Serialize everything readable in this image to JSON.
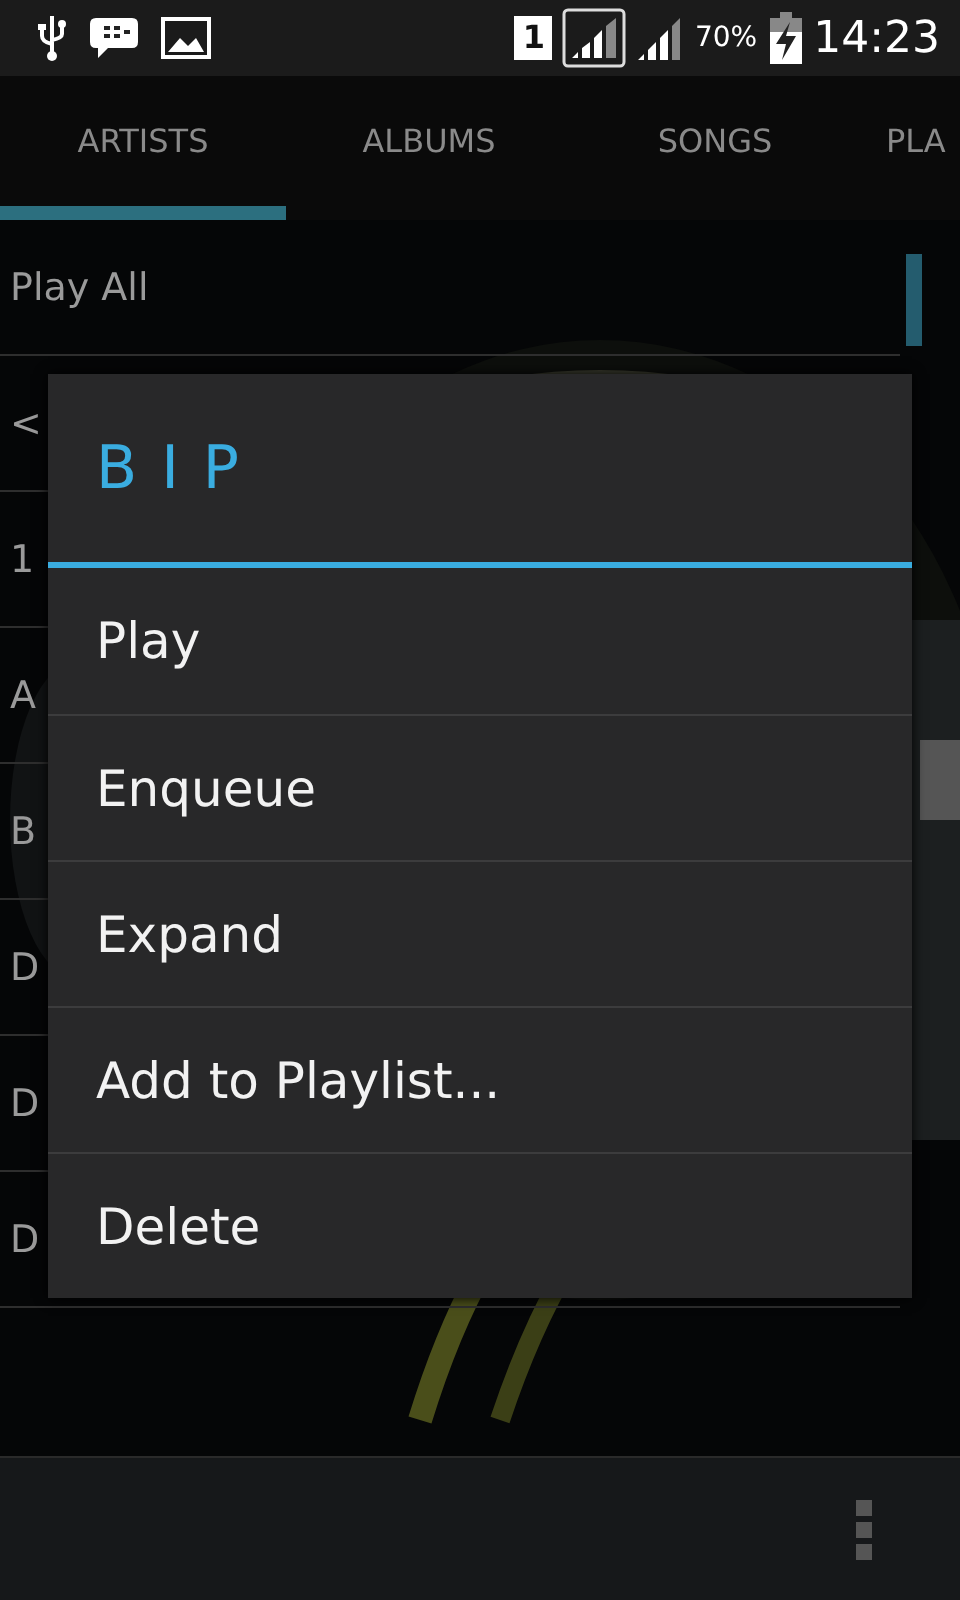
{
  "status_bar": {
    "sim": "1",
    "battery": "70%",
    "time": "14:23"
  },
  "tabs": [
    {
      "label": "ARTISTS",
      "selected": true
    },
    {
      "label": "ALBUMS",
      "selected": false
    },
    {
      "label": "SONGS",
      "selected": false
    },
    {
      "label": "PLA",
      "selected": false
    }
  ],
  "list": {
    "items": [
      "Play All",
      "<",
      "1",
      "A",
      "B",
      "D",
      "D",
      "D"
    ]
  },
  "dialog": {
    "title": "BIP",
    "items": [
      "Play",
      "Enqueue",
      "Expand",
      "Add to Playlist...",
      "Delete"
    ]
  }
}
